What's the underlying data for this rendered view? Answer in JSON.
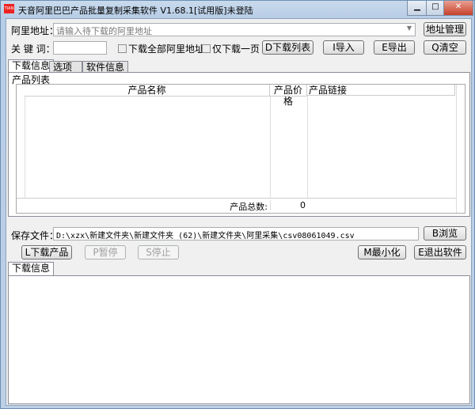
{
  "window": {
    "title": "天音阿里巴巴产品批量复制采集软件 V1.68.1[试用版]未登陆",
    "icon": "app-logo-icon",
    "controls": [
      "minimize",
      "maximize",
      "close"
    ]
  },
  "top": {
    "address_label": "阿里地址：",
    "address_placeholder": "请输入待下载的阿里地址",
    "address_manage": "地址管理",
    "keyword_label": "关 键 词：",
    "keyword_value": "",
    "check_all": "下载全部阿里地址",
    "check_one_page": "仅下载一页",
    "download_list": "D下载列表",
    "import": "I导入",
    "export": "E导出",
    "clear": "Q清空"
  },
  "tabs": [
    {
      "label": "下载信息",
      "active": true
    },
    {
      "label": "选项"
    },
    {
      "label": "软件信息"
    }
  ],
  "product_list": {
    "group_label": "产品列表",
    "columns": [
      "产品名称",
      "产品价格",
      "产品链接"
    ],
    "rows": [],
    "total_label": "产品总数:",
    "total_value": "0"
  },
  "save": {
    "label": "保存文件：",
    "path": "D:\\xzx\\新建文件夹\\新建文件夹 (62)\\新建文件夹\\阿里采集\\csv08061049.csv",
    "browse": "B浏览"
  },
  "actions": {
    "download": "L下载产品",
    "pause": "P暂停",
    "stop": "S停止",
    "minimize": "M最小化",
    "exit": "E退出软件"
  },
  "log": {
    "tab": "下载信息",
    "content": ""
  }
}
